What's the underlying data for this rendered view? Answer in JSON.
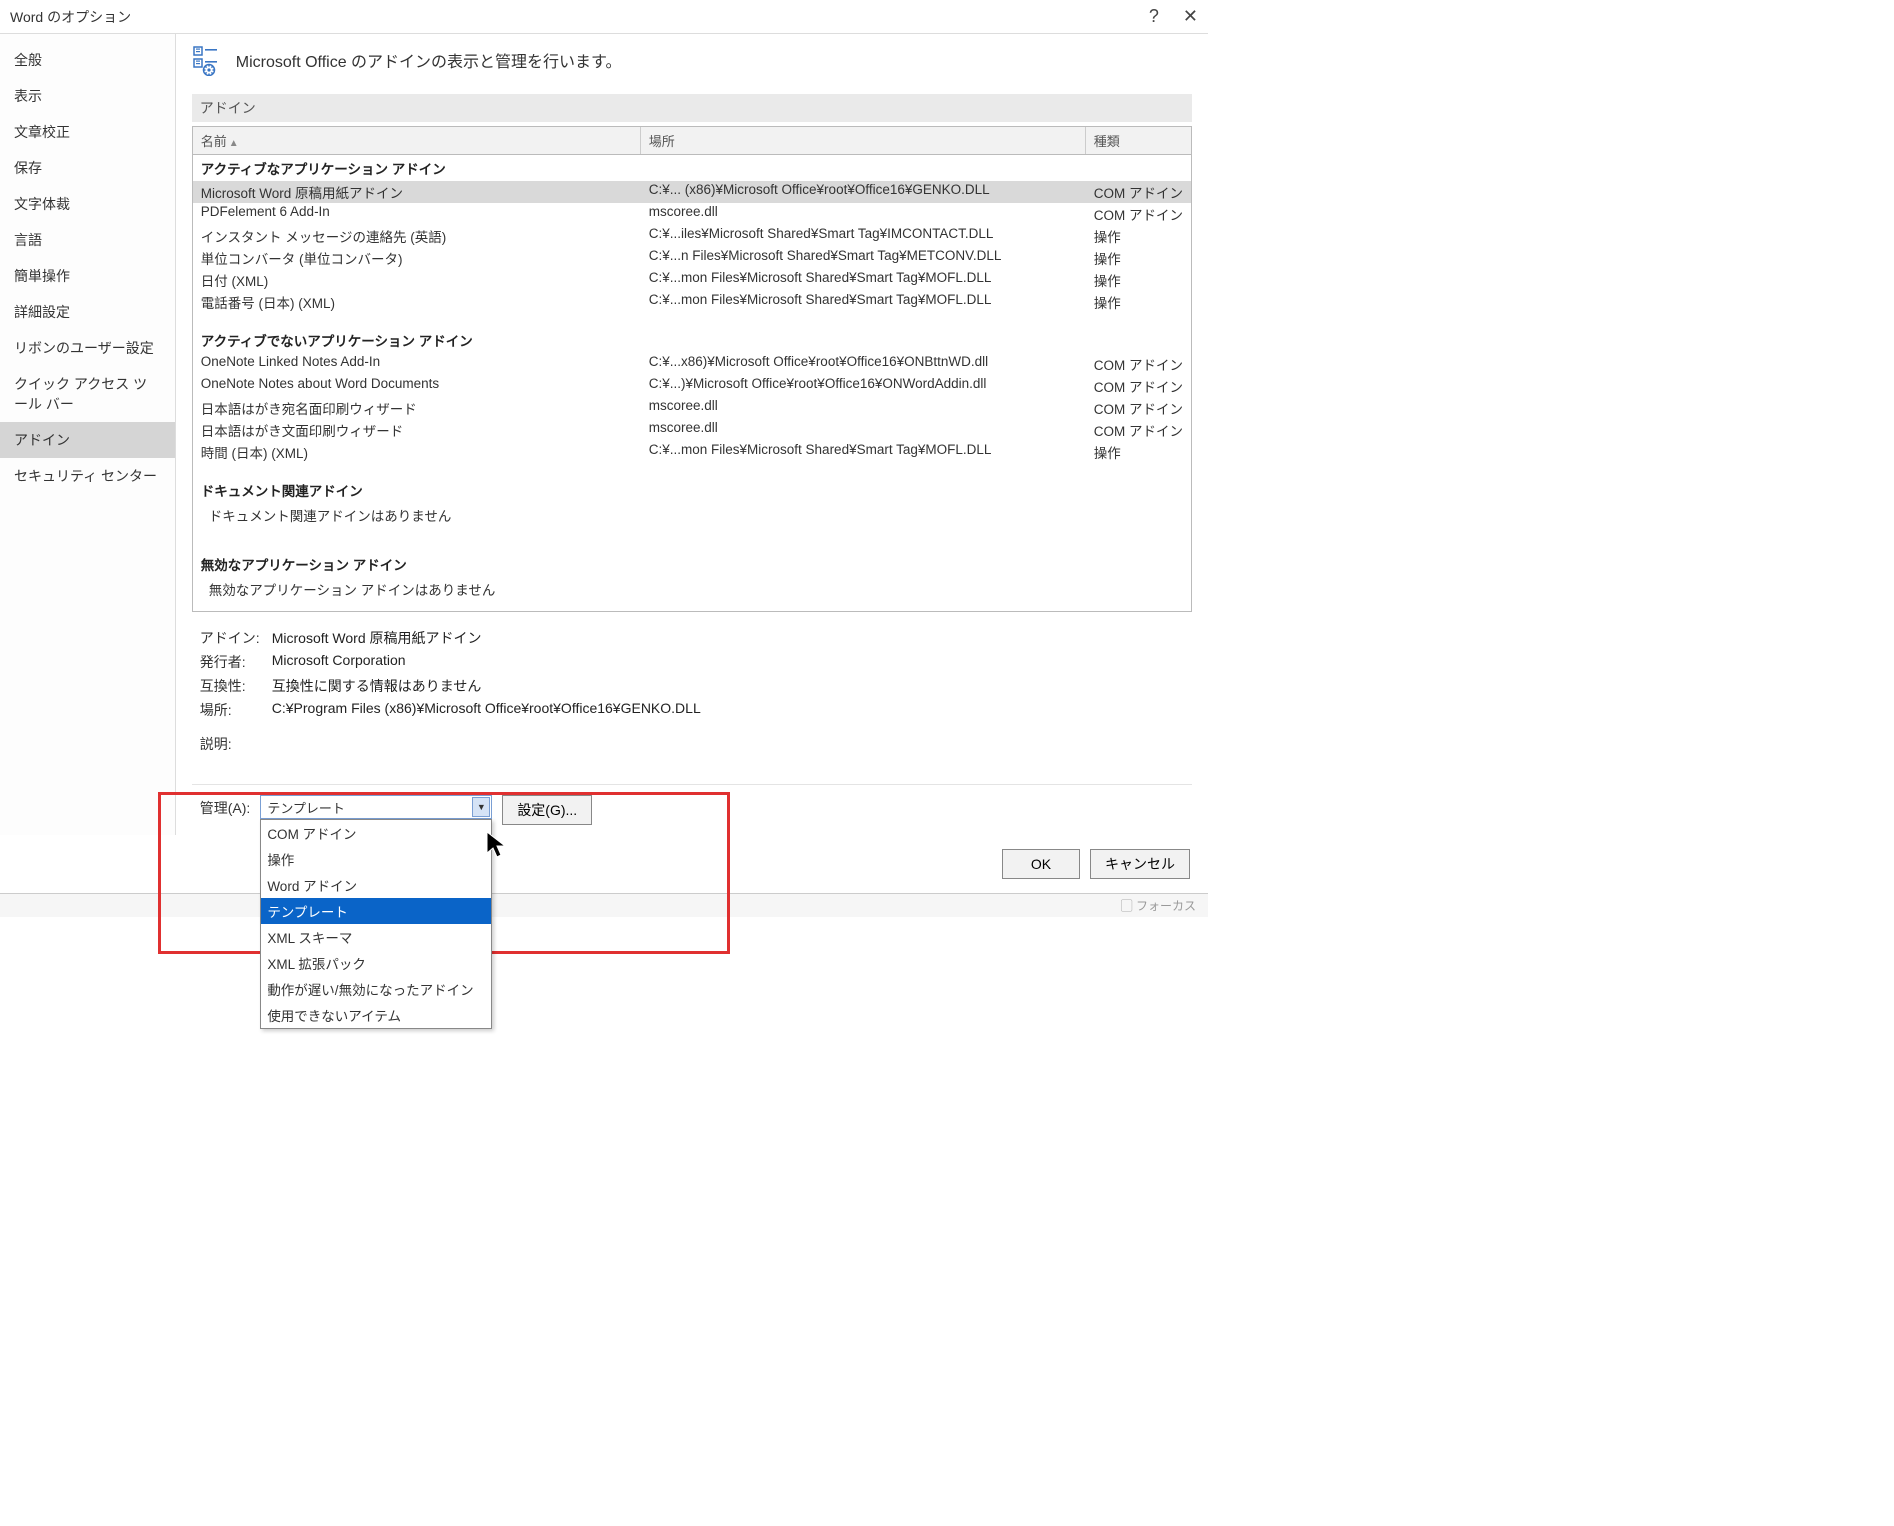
{
  "titlebar": {
    "title": "Word のオプション"
  },
  "sidebar": {
    "items": [
      {
        "label": "全般"
      },
      {
        "label": "表示"
      },
      {
        "label": "文章校正"
      },
      {
        "label": "保存"
      },
      {
        "label": "文字体裁"
      },
      {
        "label": "言語"
      },
      {
        "label": "簡単操作"
      },
      {
        "label": "詳細設定"
      },
      {
        "label": "リボンのユーザー設定"
      },
      {
        "label": "クイック アクセス ツール バー"
      },
      {
        "label": "アドイン"
      },
      {
        "label": "セキュリティ センター"
      }
    ],
    "selected_index": 10
  },
  "header": {
    "text": "Microsoft Office のアドインの表示と管理を行います。"
  },
  "section": {
    "label": "アドイン"
  },
  "table": {
    "headers": {
      "name": "名前",
      "location": "場所",
      "type": "種類"
    },
    "groups": [
      {
        "title": "アクティブなアプリケーション アドイン",
        "rows": [
          {
            "name": "Microsoft Word 原稿用紙アドイン",
            "location": "C:¥... (x86)¥Microsoft Office¥root¥Office16¥GENKO.DLL",
            "type": "COM アドイン",
            "selected": true
          },
          {
            "name": "PDFelement 6 Add-In",
            "location": "mscoree.dll",
            "type": "COM アドイン"
          },
          {
            "name": "インスタント メッセージの連絡先 (英語)",
            "location": "C:¥...iles¥Microsoft Shared¥Smart Tag¥IMCONTACT.DLL",
            "type": "操作"
          },
          {
            "name": "単位コンバータ (単位コンバータ)",
            "location": "C:¥...n Files¥Microsoft Shared¥Smart Tag¥METCONV.DLL",
            "type": "操作"
          },
          {
            "name": "日付 (XML)",
            "location": "C:¥...mon Files¥Microsoft Shared¥Smart Tag¥MOFL.DLL",
            "type": "操作"
          },
          {
            "name": "電話番号 (日本) (XML)",
            "location": "C:¥...mon Files¥Microsoft Shared¥Smart Tag¥MOFL.DLL",
            "type": "操作"
          }
        ]
      },
      {
        "title": "アクティブでないアプリケーション アドイン",
        "rows": [
          {
            "name": "OneNote Linked Notes Add-In",
            "location": "C:¥...x86)¥Microsoft Office¥root¥Office16¥ONBttnWD.dll",
            "type": "COM アドイン"
          },
          {
            "name": "OneNote Notes about Word Documents",
            "location": "C:¥...)¥Microsoft Office¥root¥Office16¥ONWordAddin.dll",
            "type": "COM アドイン"
          },
          {
            "name": "日本語はがき宛名面印刷ウィザード",
            "location": "mscoree.dll",
            "type": "COM アドイン"
          },
          {
            "name": "日本語はがき文面印刷ウィザード",
            "location": "mscoree.dll",
            "type": "COM アドイン"
          },
          {
            "name": "時間 (日本) (XML)",
            "location": "C:¥...mon Files¥Microsoft Shared¥Smart Tag¥MOFL.DLL",
            "type": "操作"
          }
        ]
      },
      {
        "title": "ドキュメント関連アドイン",
        "empty": "ドキュメント関連アドインはありません"
      },
      {
        "title": "無効なアプリケーション アドイン",
        "empty": "無効なアプリケーション アドインはありません"
      }
    ]
  },
  "detail": {
    "labels": {
      "addin": "アドイン:",
      "publisher": "発行者:",
      "compat": "互換性:",
      "location": "場所:",
      "description": "説明:"
    },
    "values": {
      "addin": "Microsoft Word 原稿用紙アドイン",
      "publisher": "Microsoft Corporation",
      "compat": "互換性に関する情報はありません",
      "location": "C:¥Program Files (x86)¥Microsoft Office¥root¥Office16¥GENKO.DLL",
      "description": ""
    }
  },
  "manage": {
    "label": "管理(A):",
    "current": "テンプレート",
    "options": [
      "COM アドイン",
      "操作",
      "Word アドイン",
      "テンプレート",
      "XML スキーマ",
      "XML 拡張パック",
      "動作が遅い/無効になったアドイン",
      "使用できないアイテム"
    ],
    "highlight_index": 3,
    "go_button": "設定(G)..."
  },
  "footer": {
    "ok": "OK",
    "cancel": "キャンセル"
  },
  "statusbar": {
    "focus": "フォーカス"
  }
}
